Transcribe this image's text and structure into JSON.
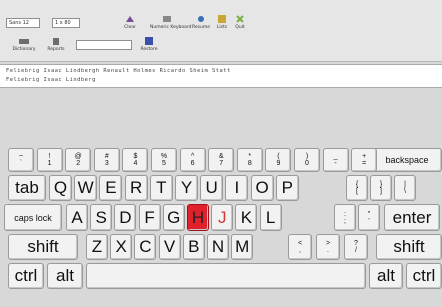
{
  "toolbar": {
    "field1_value": "Sans 12",
    "field2_value": "1 x 80",
    "field3_value": "",
    "btn_a_label": "Clear",
    "btn_b_label": "Numeric Keyboard",
    "btn_c_label": "Resume",
    "btn_d_label": "Lists",
    "btn_e_label": "Quit",
    "btn_f_label": "Dictionary",
    "btn_g_label": "Reports",
    "btn_h_label": "Restore",
    "tick_a": "✓",
    "tick_b": "✓"
  },
  "text": {
    "line1": "Feliebrig Isaac Lindbergh Renault Holmes Ricardo Sheim Statt",
    "line2": "Feliebrig Isaac Lindberg"
  },
  "keyboard": {
    "row1": [
      {
        "top": "~",
        "bottom": "`"
      },
      {
        "top": "!",
        "bottom": "1"
      },
      {
        "top": "@",
        "bottom": "2"
      },
      {
        "top": "#",
        "bottom": "3"
      },
      {
        "top": "$",
        "bottom": "4"
      },
      {
        "top": "%",
        "bottom": "5"
      },
      {
        "top": "^",
        "bottom": "6"
      },
      {
        "top": "&",
        "bottom": "7"
      },
      {
        "top": "*",
        "bottom": "8"
      },
      {
        "top": "(",
        "bottom": "9"
      },
      {
        "top": ")",
        "bottom": "0"
      },
      {
        "top": "_",
        "bottom": "-"
      },
      {
        "top": "+",
        "bottom": "="
      }
    ],
    "backspace": "backspace",
    "tab": "tab",
    "row2": [
      "Q",
      "W",
      "E",
      "R",
      "T",
      "Y",
      "U",
      "I",
      "O",
      "P"
    ],
    "row2_extra": [
      {
        "top": "{",
        "bottom": "["
      },
      {
        "top": "}",
        "bottom": "]"
      },
      {
        "top": "|",
        "bottom": "\\"
      }
    ],
    "caps": "caps lock",
    "row3": [
      "A",
      "S",
      "D",
      "F",
      "G",
      "H",
      "J",
      "K",
      "L"
    ],
    "row3_extra": [
      {
        "top": ":",
        "bottom": ";"
      },
      {
        "top": "\"",
        "bottom": "'"
      }
    ],
    "enter": "enter",
    "shift_left": "shift",
    "row4": [
      "Z",
      "X",
      "C",
      "V",
      "B",
      "N",
      "M"
    ],
    "row4_extra": [
      {
        "top": "<",
        "bottom": ","
      },
      {
        "top": ">",
        "bottom": "."
      },
      {
        "top": "?",
        "bottom": "/"
      }
    ],
    "shift_right": "shift",
    "ctrl_left": "ctrl",
    "alt_left": "alt",
    "space": "",
    "alt_right": "alt",
    "ctrl_right": "ctrl",
    "highlight_red": "H",
    "highlight_pink": "J",
    "colors": {
      "red": "#e0202a",
      "pink": "#d03a3a"
    }
  }
}
